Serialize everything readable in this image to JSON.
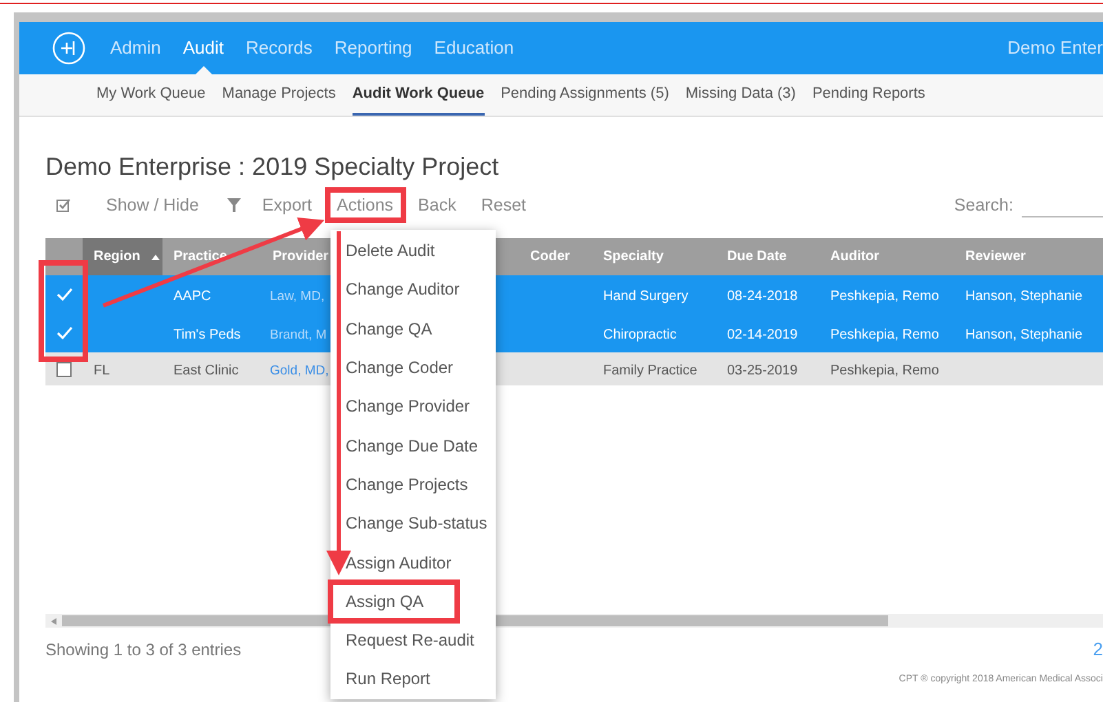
{
  "nav": {
    "items": [
      {
        "label": "Admin",
        "selected": false
      },
      {
        "label": "Audit",
        "selected": true
      },
      {
        "label": "Records",
        "selected": false
      },
      {
        "label": "Reporting",
        "selected": false
      },
      {
        "label": "Education",
        "selected": false
      }
    ],
    "account": "Demo Enter"
  },
  "subnav": [
    {
      "label": "My Work Queue",
      "selected": false
    },
    {
      "label": "Manage Projects",
      "selected": false
    },
    {
      "label": "Audit Work Queue",
      "selected": true
    },
    {
      "label": "Pending Assignments (5)",
      "selected": false
    },
    {
      "label": "Missing Data (3)",
      "selected": false
    },
    {
      "label": "Pending Reports",
      "selected": false
    }
  ],
  "title": "Demo Enterprise : 2019 Specialty Project",
  "toolbar": [
    {
      "kind": "checkbox",
      "label": "Show / Hide",
      "highlighted": false
    },
    {
      "kind": "filter",
      "label": "Export",
      "highlighted": false
    },
    {
      "kind": "text",
      "label": "Actions",
      "highlighted": true
    },
    {
      "kind": "text",
      "label": "Back",
      "highlighted": false
    },
    {
      "kind": "text",
      "label": "Reset",
      "highlighted": false
    }
  ],
  "search": {
    "label": "Search:"
  },
  "table": {
    "columns": [
      {
        "label": "Region",
        "sorted": true
      },
      {
        "label": "Practice",
        "sorted": false
      },
      {
        "label": "Provider",
        "sorted": false
      },
      {
        "label": "Coder",
        "sorted": false
      },
      {
        "label": "Specialty",
        "sorted": false
      },
      {
        "label": "Due Date",
        "sorted": false
      },
      {
        "label": "Auditor",
        "sorted": false
      },
      {
        "label": "Reviewer",
        "sorted": false
      }
    ],
    "rows": [
      {
        "selected": true,
        "cells": [
          "",
          "AAPC",
          "Law, MD,",
          "",
          "Hand Surgery",
          "08-24-2018",
          "Peshkepia, Remo",
          "Hanson, Stephanie"
        ]
      },
      {
        "selected": true,
        "cells": [
          "",
          "Tim's Peds",
          "Brandt, M",
          "",
          "Chiropractic",
          "02-14-2019",
          "Peshkepia, Remo",
          "Hanson, Stephanie"
        ]
      },
      {
        "selected": false,
        "cells": [
          "FL",
          "East Clinic",
          "Gold, MD,",
          "",
          "Family Practice",
          "03-25-2019",
          "Peshkepia, Remo",
          ""
        ]
      }
    ]
  },
  "info": "Showing 1 to 3 of 3 entries",
  "pager": "2",
  "copyright": "CPT ® copyright 2018 American Medical Associ",
  "actions_menu": [
    {
      "label": "Delete Audit",
      "highlighted": false
    },
    {
      "label": "Change Auditor",
      "highlighted": false
    },
    {
      "label": "Change QA",
      "highlighted": false
    },
    {
      "label": "Change Coder",
      "highlighted": false
    },
    {
      "label": "Change Provider",
      "highlighted": false
    },
    {
      "label": "Change Due Date",
      "highlighted": false
    },
    {
      "label": "Change Projects",
      "highlighted": false
    },
    {
      "label": "Change Sub-status",
      "highlighted": false
    },
    {
      "label": "Assign Auditor",
      "highlighted": false
    },
    {
      "label": "Assign QA",
      "highlighted": true
    },
    {
      "label": "Request Re-audit",
      "highlighted": false
    },
    {
      "label": "Run Report",
      "highlighted": false
    }
  ]
}
